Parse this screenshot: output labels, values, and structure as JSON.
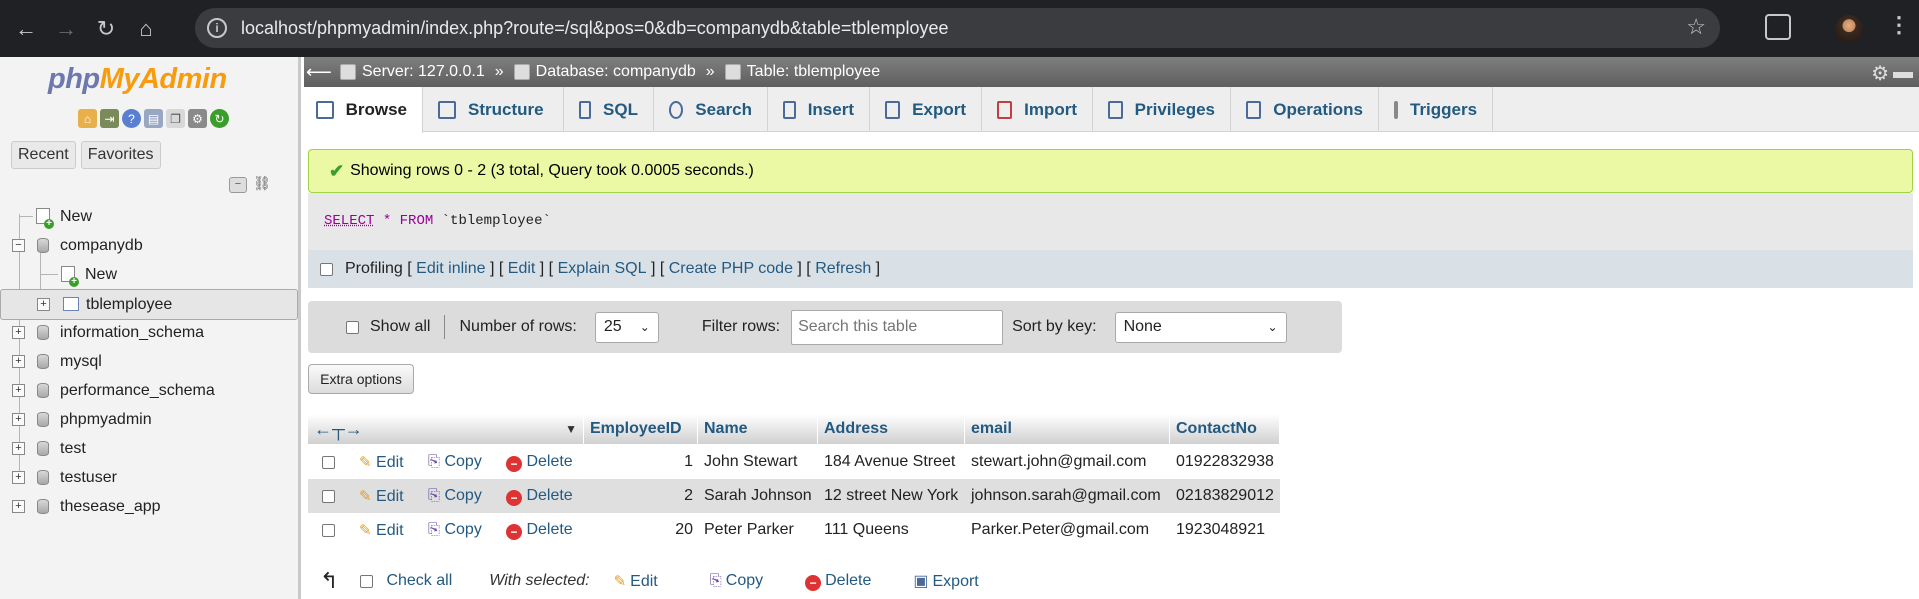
{
  "browser": {
    "url": "localhost/phpmyadmin/index.php?route=/sql&pos=0&db=companydb&table=tblemployee"
  },
  "sidebar": {
    "logo_php": "php",
    "logo_myadmin": "MyAdmin",
    "recent_label": "Recent",
    "favorites_label": "Favorites",
    "tree": [
      {
        "label": "New"
      },
      {
        "label": "companydb"
      },
      {
        "label": "New"
      },
      {
        "label": "tblemployee"
      },
      {
        "label": "information_schema"
      },
      {
        "label": "mysql"
      },
      {
        "label": "performance_schema"
      },
      {
        "label": "phpmyadmin"
      },
      {
        "label": "test"
      },
      {
        "label": "testuser"
      },
      {
        "label": "thesease_app"
      }
    ]
  },
  "breadcrumb": {
    "server": "Server: 127.0.0.1",
    "database": "Database: companydb",
    "table": "Table: tblemployee",
    "sep": "»"
  },
  "tabs": [
    "Browse",
    "Structure",
    "SQL",
    "Search",
    "Insert",
    "Export",
    "Import",
    "Privileges",
    "Operations",
    "Triggers"
  ],
  "message": "Showing rows 0 - 2 (3 total, Query took 0.0005 seconds.)",
  "query": {
    "select": "SELECT",
    "star": "*",
    "from": "FROM",
    "table": "`tblemployee`"
  },
  "profiling": {
    "label": "Profiling",
    "edit_inline": "Edit inline",
    "edit": "Edit",
    "explain": "Explain SQL",
    "create_php": "Create PHP code",
    "refresh": "Refresh"
  },
  "filter": {
    "show_all": "Show all",
    "rows_label": "Number of rows:",
    "rows_value": "25",
    "filter_label": "Filter rows:",
    "filter_placeholder": "Search this table",
    "sort_label": "Sort by key:",
    "sort_value": "None"
  },
  "extra_options": "Extra options",
  "table": {
    "columns": [
      "EmployeeID",
      "Name",
      "Address",
      "email",
      "ContactNo"
    ],
    "actions": {
      "edit": "Edit",
      "copy": "Copy",
      "delete": "Delete"
    },
    "rows": [
      {
        "id": "1",
        "name": "John Stewart",
        "address": "184 Avenue Street",
        "email": "stewart.john@gmail.com",
        "contact": "01922832938"
      },
      {
        "id": "2",
        "name": "Sarah Johnson",
        "address": "12 street New York",
        "email": "johnson.sarah@gmail.com",
        "contact": "02183829012"
      },
      {
        "id": "20",
        "name": "Peter Parker",
        "address": "111 Queens",
        "email": "Parker.Peter@gmail.com",
        "contact": "1923048921"
      }
    ]
  },
  "footer": {
    "check_all": "Check all",
    "with_selected": "With selected:",
    "edit": "Edit",
    "copy": "Copy",
    "delete": "Delete",
    "export": "Export"
  }
}
